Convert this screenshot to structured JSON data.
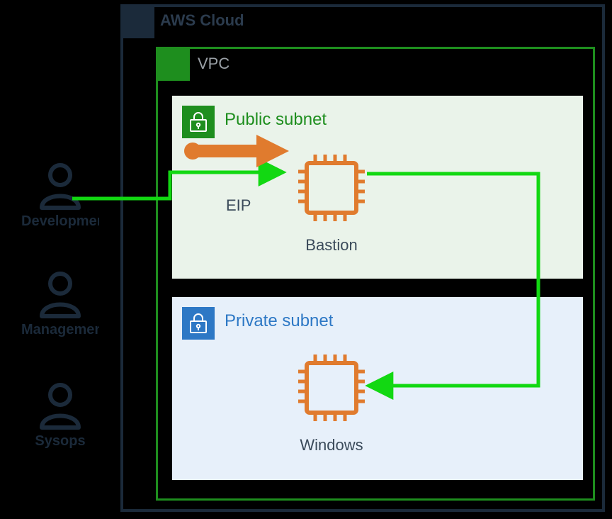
{
  "users": [
    {
      "label": "Development"
    },
    {
      "label": "Management"
    },
    {
      "label": "Sysops"
    }
  ],
  "cloud": {
    "title": "AWS Cloud"
  },
  "vpc": {
    "title": "VPC"
  },
  "public": {
    "title": "Public subnet",
    "instance": "Bastion",
    "eip": "EIP"
  },
  "private": {
    "title": "Private subnet",
    "instance": "Windows"
  },
  "colors": {
    "orange": "#e07b2e",
    "green": "#12d812",
    "darkblue": "#1b2a3a"
  }
}
